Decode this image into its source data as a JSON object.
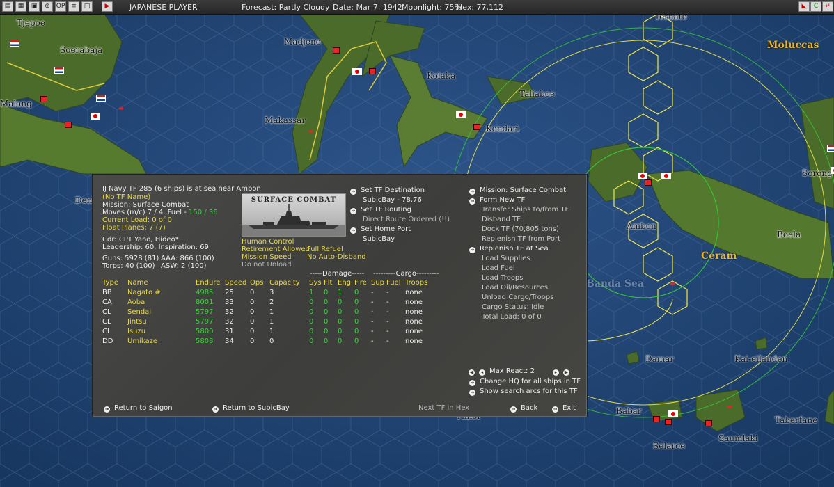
{
  "topbar": {
    "player": "JAPANESE PLAYER",
    "forecast": "Forecast: Partly Cloudy",
    "date": "Date: Mar 7, 1942",
    "moonlight": "Moonlight: 75%",
    "hex": "Hex: 77,112"
  },
  "map": {
    "places": [
      "Tjepoe",
      "Soerabaja",
      "Malang",
      "Madjene",
      "Kolaka",
      "Makassar",
      "Kendari",
      "Taliaboe",
      "Ternate",
      "Ambon",
      "Boela",
      "Sorong",
      "Damar",
      "Kai-eilanden",
      "Babar",
      "Taberfane",
      "Saumlaki",
      "Selaroe",
      "Den",
      "Timor"
    ],
    "regions": [
      "Moluccas",
      "Ceram",
      "Banda Sea"
    ]
  },
  "tf": {
    "header": "IJ Navy TF 285 (6 ships) is at sea near Ambon",
    "name": "(No TF Name)",
    "mission": "Mission: Surface Combat",
    "moves_prefix": "Moves (m/c) 7 / 4, Fuel - ",
    "fuel": "150 / 36",
    "current_load": "Current Load: 0 of 0",
    "float_planes": "Float Planes: 7 (7)",
    "cdr": "Cdr: CPT Yano, Hideo*",
    "leadership": "Leadership: 60, Inspiration: 69",
    "guns": "Guns: 5928 (81)",
    "aaa": "AAA: 866 (100)",
    "torps": "Torps: 40 (100)",
    "asw": "ASW: 2 (100)",
    "image_caption": "SURFACE COMBAT",
    "human_control": "Human Control",
    "retirement": "Retirement Allowed",
    "full_refuel": "Full Refuel",
    "mission_speed": "Mission Speed",
    "no_auto_disband": "No Auto-Disband",
    "do_not_unload": "Do not Unload"
  },
  "routing": {
    "set_destination": "Set TF Destination",
    "destination": "SubicBay - 78,76",
    "set_routing": "Set TF Routing",
    "direct_route": "Direct Route Ordered (!!)",
    "set_home_port": "Set Home Port",
    "home_port": "SubicBay"
  },
  "orders": {
    "mission": "Mission: Surface Combat",
    "form_new": "Form New TF",
    "transfer": "Transfer Ships to/from TF",
    "disband": "Disband TF",
    "dock": "Dock TF (70,805 tons)",
    "replenish_port": "Replenish TF from Port",
    "replenish_sea": "Replenish TF at Sea",
    "load_supplies": "Load Supplies",
    "load_fuel": "Load Fuel",
    "load_troops": "Load Troops",
    "load_oil": "Load Oil/Resources",
    "unload": "Unload Cargo/Troops",
    "cargo_status": "Cargo Status: Idle",
    "total_load": "Total Load: 0 of 0"
  },
  "table": {
    "damage_group": "-----Damage-----",
    "cargo_group": "---------Cargo---------",
    "headers": [
      "Type",
      "Name",
      "Endure",
      "Speed",
      "Ops",
      "Capacity",
      "Sys",
      "Flt",
      "Eng",
      "Fire",
      "Sup",
      "Fuel",
      "Troops"
    ],
    "rows": [
      [
        "BB",
        "Nagato #",
        "4985",
        "25",
        "0",
        "3",
        "1",
        "0",
        "1",
        "0",
        "-",
        "-",
        "none"
      ],
      [
        "CA",
        "Aoba",
        "8001",
        "33",
        "0",
        "2",
        "0",
        "0",
        "0",
        "0",
        "-",
        "-",
        "none"
      ],
      [
        "CL",
        "Sendai",
        "5797",
        "32",
        "0",
        "1",
        "0",
        "0",
        "0",
        "0",
        "-",
        "-",
        "none"
      ],
      [
        "CL",
        "Jintsu",
        "5797",
        "32",
        "0",
        "1",
        "0",
        "0",
        "0",
        "0",
        "-",
        "-",
        "none"
      ],
      [
        "CL",
        "Isuzu",
        "5800",
        "31",
        "0",
        "1",
        "0",
        "0",
        "0",
        "0",
        "-",
        "-",
        "none"
      ],
      [
        "DD",
        "Umikaze",
        "5808",
        "34",
        "0",
        "0",
        "0",
        "0",
        "0",
        "0",
        "-",
        "-",
        "none"
      ]
    ]
  },
  "bottom": {
    "max_react": "Max React: 2",
    "change_hq": "Change HQ for all ships in TF",
    "search_arcs": "Show search arcs for this TF",
    "return_saigon": "Return to Saigon",
    "return_subic": "Return to SubicBay",
    "next_tf": "Next TF in Hex",
    "back": "Back",
    "exit": "Exit"
  },
  "colors": {
    "accent_yellow": "#e7d84c",
    "accent_green": "#3ed03e",
    "panel": "#454542"
  }
}
